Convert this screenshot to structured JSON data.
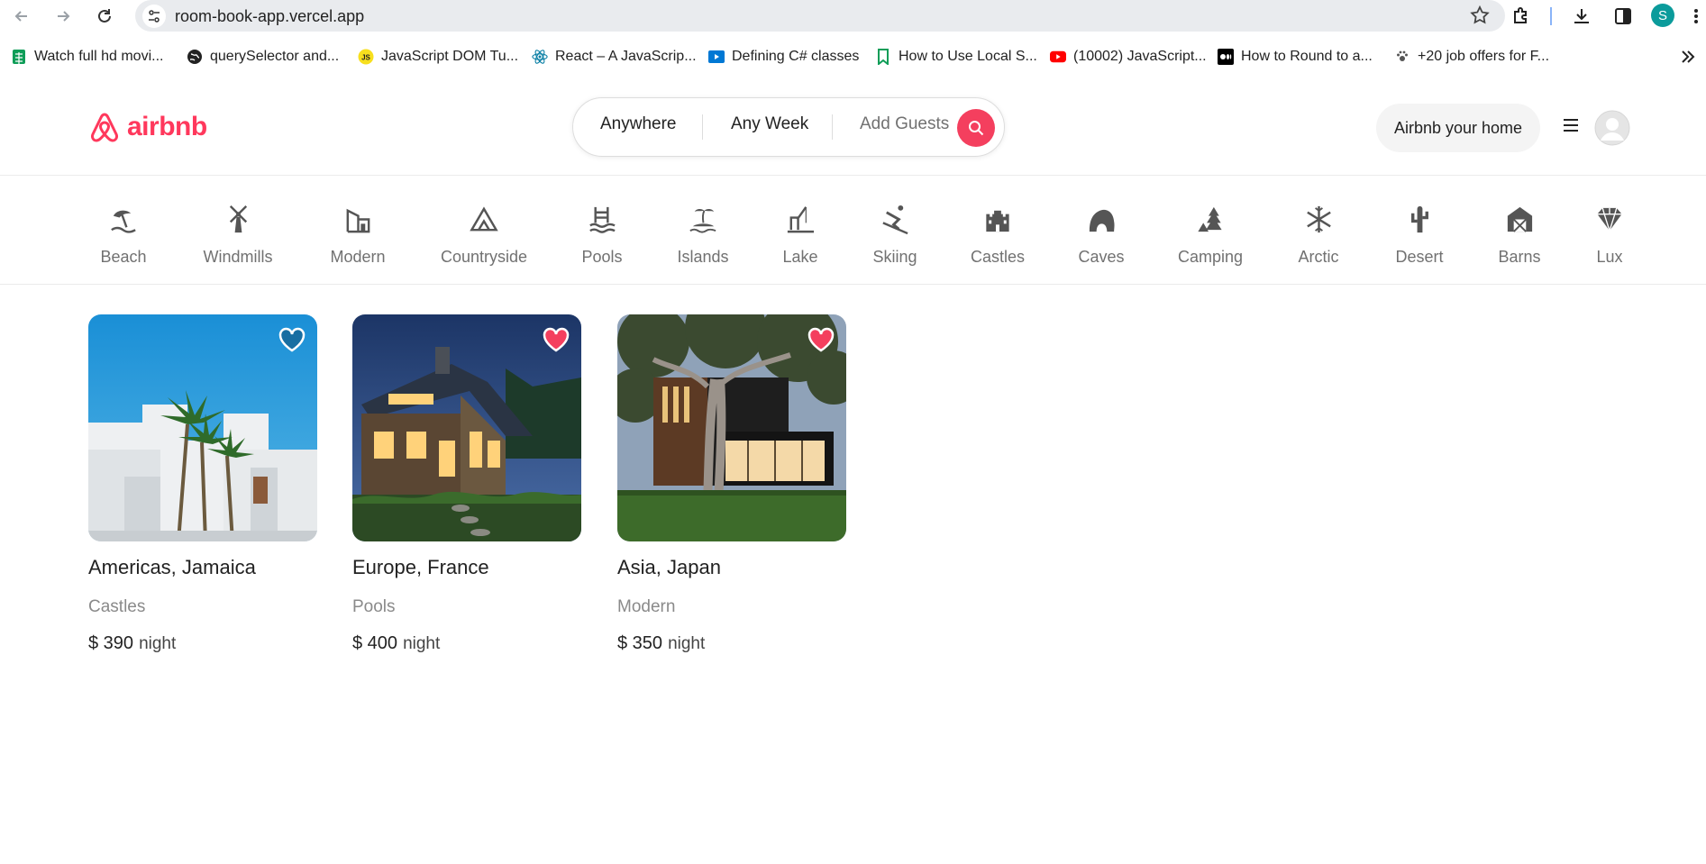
{
  "browser": {
    "url": "room-book-app.vercel.app",
    "profile_initial": "S",
    "bookmarks": [
      {
        "label": "Watch full hd movi...",
        "icon": "sheets-icon"
      },
      {
        "label": "querySelector and...",
        "icon": "globe-icon"
      },
      {
        "label": "JavaScript DOM Tu...",
        "icon": "js-icon"
      },
      {
        "label": "React – A JavaScrip...",
        "icon": "react-icon"
      },
      {
        "label": "Defining C# classes",
        "icon": "video-icon"
      },
      {
        "label": "How to Use Local S...",
        "icon": "bookmark-green-icon"
      },
      {
        "label": "(10002) JavaScript...",
        "icon": "youtube-icon"
      },
      {
        "label": "How to Round to a...",
        "icon": "medium-icon"
      },
      {
        "label": "+20 job offers for F...",
        "icon": "paw-icon"
      }
    ]
  },
  "header": {
    "logo_text": "airbnb",
    "search": {
      "where": "Anywhere",
      "when": "Any Week",
      "guests": "Add Guests"
    },
    "host_button": "Airbnb your home"
  },
  "categories": [
    {
      "label": "Beach",
      "icon": "beach-icon"
    },
    {
      "label": "Windmills",
      "icon": "windmill-icon"
    },
    {
      "label": "Modern",
      "icon": "modern-building-icon"
    },
    {
      "label": "Countryside",
      "icon": "mountain-icon"
    },
    {
      "label": "Pools",
      "icon": "pool-icon"
    },
    {
      "label": "Islands",
      "icon": "island-icon"
    },
    {
      "label": "Lake",
      "icon": "fishing-icon"
    },
    {
      "label": "Skiing",
      "icon": "skiing-icon"
    },
    {
      "label": "Castles",
      "icon": "castle-icon"
    },
    {
      "label": "Caves",
      "icon": "cave-icon"
    },
    {
      "label": "Camping",
      "icon": "camping-icon"
    },
    {
      "label": "Arctic",
      "icon": "snowflake-icon"
    },
    {
      "label": "Desert",
      "icon": "cactus-icon"
    },
    {
      "label": "Barns",
      "icon": "barn-icon"
    },
    {
      "label": "Lux",
      "icon": "diamond-icon"
    }
  ],
  "listings": [
    {
      "location": "Americas, Jamaica",
      "category": "Castles",
      "price": "$ 390",
      "unit": "night",
      "favorited": false
    },
    {
      "location": "Europe, France",
      "category": "Pools",
      "price": "$ 400",
      "unit": "night",
      "favorited": true
    },
    {
      "location": "Asia, Japan",
      "category": "Modern",
      "price": "$ 350",
      "unit": "night",
      "favorited": true
    }
  ],
  "colors": {
    "brand": "#ff385c",
    "heart_active": "#f43f5e",
    "muted_text": "#717171"
  }
}
